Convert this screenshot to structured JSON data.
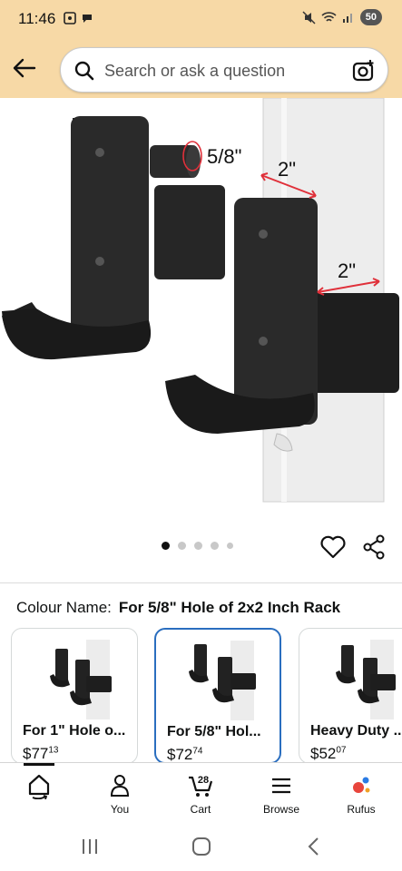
{
  "status_bar": {
    "time": "11:46",
    "battery": "50"
  },
  "search": {
    "placeholder": "Search or ask a question"
  },
  "product_image": {
    "label_hole": "5/8\"",
    "label_width_top": "2\"",
    "label_width_side": "2\"",
    "accent_color": "#e0303a"
  },
  "carousel": {
    "dots": 5,
    "active_index": 0
  },
  "colour": {
    "label": "Colour Name:",
    "value": "For 5/8\" Hole of 2x2 Inch Rack"
  },
  "variants": [
    {
      "title": "For 1\" Hole o...",
      "price_whole": "$77",
      "price_fraction": "13",
      "selected": false
    },
    {
      "title": "For 5/8\" Hol...",
      "price_whole": "$72",
      "price_fraction": "74",
      "selected": true
    },
    {
      "title": "Heavy Duty ...",
      "price_whole": "$52",
      "price_fraction": "07",
      "selected": false
    }
  ],
  "bottom_nav": {
    "items": [
      {
        "label": "",
        "icon": "home-icon"
      },
      {
        "label": "You",
        "icon": "person-icon"
      },
      {
        "label": "Cart",
        "icon": "cart-icon",
        "badge": "28"
      },
      {
        "label": "Browse",
        "icon": "menu-icon"
      },
      {
        "label": "Rufus",
        "icon": "rufus-icon"
      }
    ]
  },
  "colors": {
    "header_bg": "#f7d9a6",
    "selected_border": "#2a6ebf",
    "accent": "#e0303a"
  }
}
